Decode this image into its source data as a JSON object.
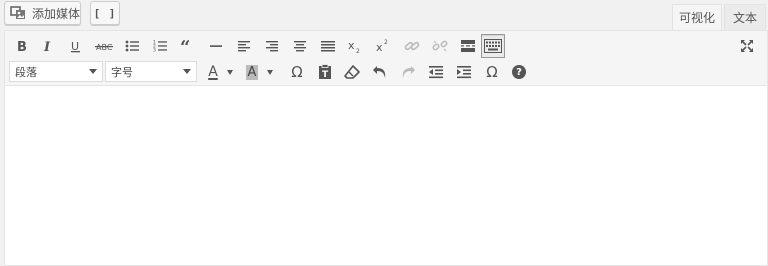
{
  "topbar": {
    "add_media_label": "添加媒体",
    "shortcode_label": "[ ]",
    "tabs": [
      {
        "label": "可视化",
        "active": true
      },
      {
        "label": "文本",
        "active": false
      }
    ]
  },
  "toolbar": {
    "format_select": "段落",
    "fontsize_select": "字号",
    "text_color_glyph": "A",
    "bg_color_glyph": "A",
    "special_char_glyph": "Ω",
    "special_char2_glyph": "Ω",
    "help_glyph": "?"
  },
  "colors": {
    "toolbar_bg": "#f5f5f5",
    "icon": "#555555",
    "disabled_icon": "#bbbbbb",
    "border": "#e5e5e5"
  },
  "icons": {
    "row1": [
      "bold-icon",
      "italic-icon",
      "underline-icon",
      "strikethrough-icon",
      "bullet-list-icon",
      "numbered-list-icon",
      "blockquote-icon",
      "horizontal-rule-icon",
      "align-left-icon",
      "align-right-icon",
      "align-center-icon",
      "justify-icon",
      "subscript-icon",
      "superscript-icon",
      "link-icon",
      "unlink-icon",
      "read-more-icon",
      "toolbar-toggle-icon",
      "fullscreen-icon"
    ],
    "row2": [
      "format-select",
      "fontsize-select",
      "text-color-icon",
      "background-color-icon",
      "special-character-icon",
      "paste-text-icon",
      "clear-formatting-icon",
      "undo-icon",
      "redo-icon",
      "outdent-icon",
      "indent-icon",
      "special-character-icon",
      "help-icon"
    ]
  }
}
